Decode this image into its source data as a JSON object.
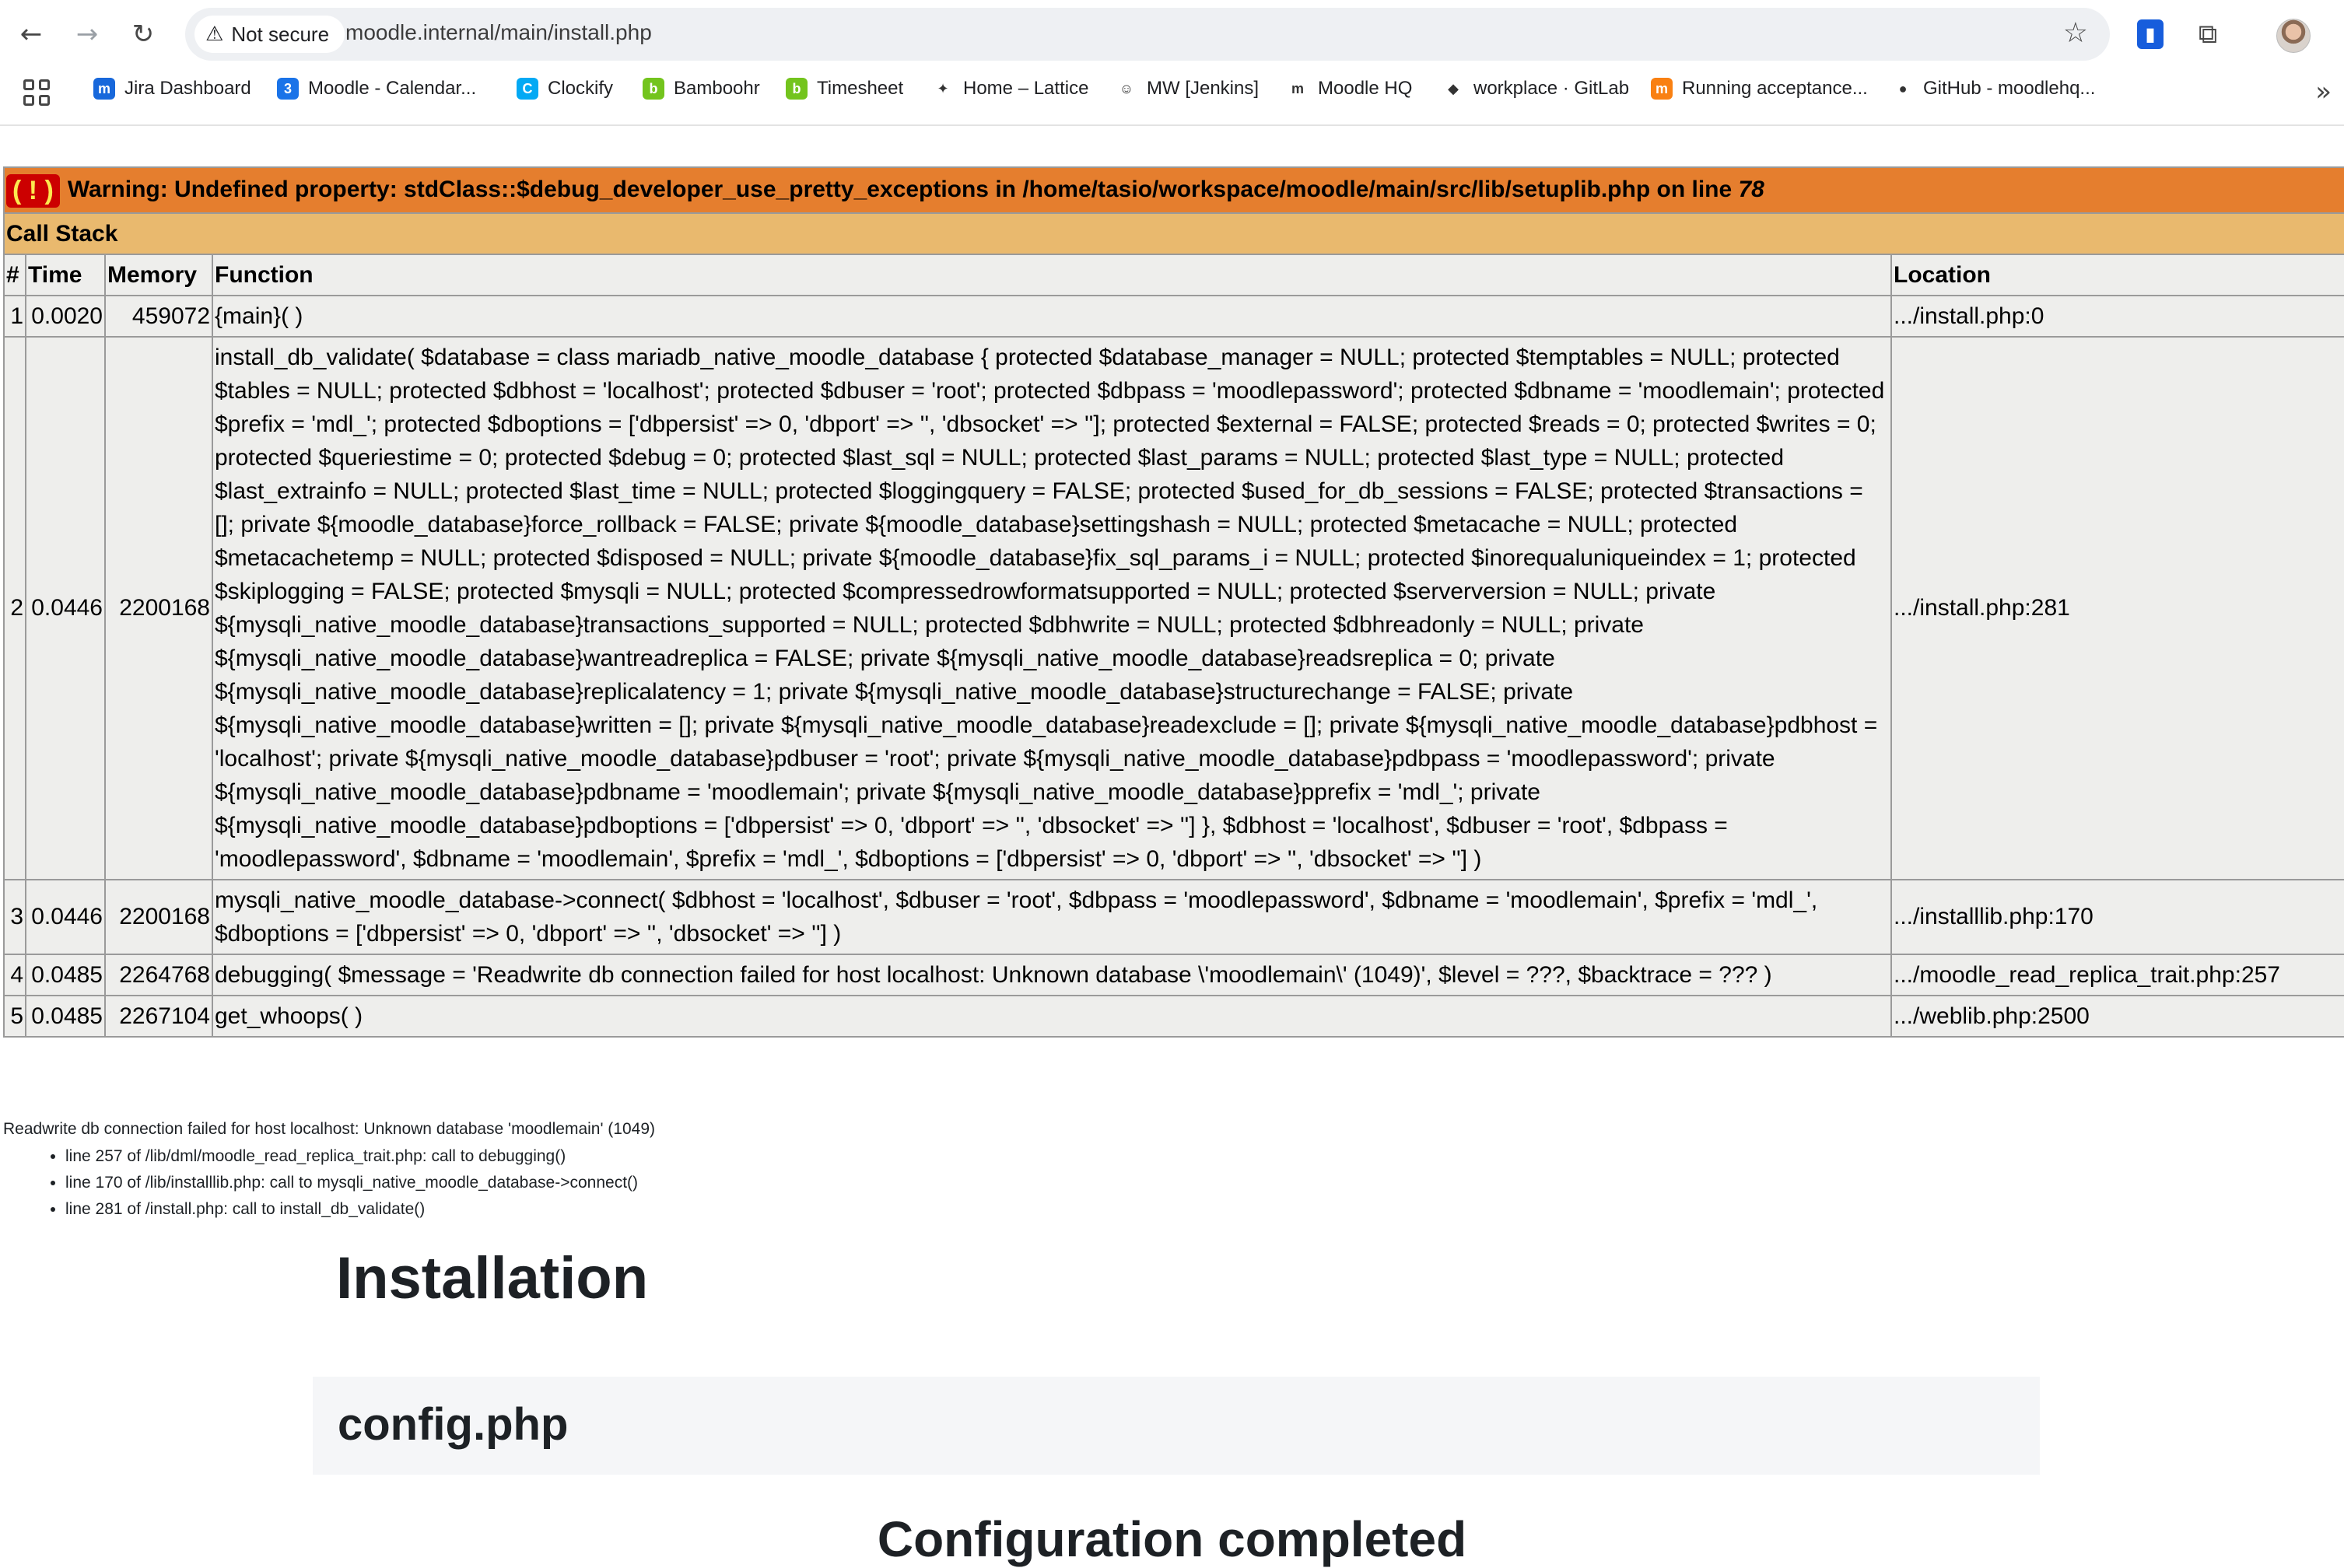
{
  "browser": {
    "security_label": "Not secure",
    "url": "moodle.internal/main/install.php",
    "bookmarks": [
      {
        "label": "Jira Dashboard",
        "color": "#1868db",
        "glyph": "m"
      },
      {
        "label": "Moodle - Calendar...",
        "color": "#1a73e8",
        "glyph": "3"
      },
      {
        "label": "Clockify",
        "color": "#03a9f4",
        "glyph": "C"
      },
      {
        "label": "Bamboohr",
        "color": "#73c41d",
        "glyph": "b"
      },
      {
        "label": "Timesheet",
        "color": "#73c41d",
        "glyph": "b"
      },
      {
        "label": "Home – Lattice",
        "color": "#ffffff",
        "glyph": "✦"
      },
      {
        "label": "MW [Jenkins]",
        "color": "#ffffff",
        "glyph": "☺"
      },
      {
        "label": "Moodle HQ",
        "color": "#ffffff",
        "glyph": "m"
      },
      {
        "label": "workplace · GitLab",
        "color": "#ffffff",
        "glyph": "◆"
      },
      {
        "label": "Running acceptance...",
        "color": "#f98012",
        "glyph": "m"
      },
      {
        "label": "GitHub - moodlehq...",
        "color": "#ffffff",
        "glyph": "●"
      }
    ]
  },
  "xdebug": {
    "badge": "( ! )",
    "warning_text": "Warning: Undefined property: stdClass::$debug_developer_use_pretty_exceptions in /home/tasio/workspace/moodle/main/src/lib/setuplib.php on line ",
    "warning_line": "78",
    "call_stack_label": "Call Stack",
    "columns": [
      "#",
      "Time",
      "Memory",
      "Function",
      "Location"
    ],
    "rows": [
      {
        "n": "1",
        "time": "0.0020",
        "memory": "459072",
        "function": "{main}( )",
        "location": ".../install.php:0"
      },
      {
        "n": "2",
        "time": "0.0446",
        "memory": "2200168",
        "function": "install_db_validate( $database = class mariadb_native_moodle_database { protected $database_manager = NULL; protected $temptables = NULL; protected $tables = NULL; protected $dbhost = 'localhost'; protected $dbuser = 'root'; protected $dbpass = 'moodlepassword'; protected $dbname = 'moodlemain'; protected $prefix = 'mdl_'; protected $dboptions = ['dbpersist' => 0, 'dbport' => '', 'dbsocket' => '']; protected $external = FALSE; protected $reads = 0; protected $writes = 0; protected $queriestime = 0; protected $debug = 0; protected $last_sql = NULL; protected $last_params = NULL; protected $last_type = NULL; protected $last_extrainfo = NULL; protected $last_time = NULL; protected $loggingquery = FALSE; protected $used_for_db_sessions = FALSE; protected $transactions = []; private ${moodle_database}force_rollback = FALSE; private ${moodle_database}settingshash = NULL; protected $metacache = NULL; protected $metacachetemp = NULL; protected $disposed = NULL; private ${moodle_database}fix_sql_params_i = NULL; protected $inorequaluniqueindex = 1; protected $skiplogging = FALSE; protected $mysqli = NULL; protected $compressedrowformatsupported = NULL; protected $serverversion = NULL; private ${mysqli_native_moodle_database}transactions_supported = NULL; protected $dbhwrite = NULL; protected $dbhreadonly = NULL; private ${mysqli_native_moodle_database}wantreadreplica = FALSE; private ${mysqli_native_moodle_database}readsreplica = 0; private ${mysqli_native_moodle_database}replicalatency = 1; private ${mysqli_native_moodle_database}structurechange = FALSE; private ${mysqli_native_moodle_database}written = []; private ${mysqli_native_moodle_database}readexclude = []; private ${mysqli_native_moodle_database}pdbhost = 'localhost'; private ${mysqli_native_moodle_database}pdbuser = 'root'; private ${mysqli_native_moodle_database}pdbpass = 'moodlepassword'; private ${mysqli_native_moodle_database}pdbname = 'moodlemain'; private ${mysqli_native_moodle_database}pprefix = 'mdl_'; private ${mysqli_native_moodle_database}pdboptions = ['dbpersist' => 0, 'dbport' => '', 'dbsocket' => ''] }, $dbhost = 'localhost', $dbuser = 'root', $dbpass = 'moodlepassword', $dbname = 'moodlemain', $prefix = 'mdl_', $dboptions = ['dbpersist' => 0, 'dbport' => '', 'dbsocket' => ''] )",
        "location": ".../install.php:281"
      },
      {
        "n": "3",
        "time": "0.0446",
        "memory": "2200168",
        "function": "mysqli_native_moodle_database->connect( $dbhost = 'localhost', $dbuser = 'root', $dbpass = 'moodlepassword', $dbname = 'moodlemain', $prefix = 'mdl_', $dboptions = ['dbpersist' => 0, 'dbport' => '', 'dbsocket' => ''] )",
        "location": ".../installlib.php:170"
      },
      {
        "n": "4",
        "time": "0.0485",
        "memory": "2264768",
        "function": "debugging( $message = 'Readwrite db connection failed for host localhost: Unknown database \\'moodlemain\\' (1049)', $level = ???, $backtrace = ??? )",
        "location": ".../moodle_read_replica_trait.php:257"
      },
      {
        "n": "5",
        "time": "0.0485",
        "memory": "2267104",
        "function": "get_whoops( )",
        "location": ".../weblib.php:2500"
      }
    ]
  },
  "debug_message": {
    "text": "Readwrite db connection failed for host localhost: Unknown database 'moodlemain' (1049)",
    "trace": [
      "line 257 of /lib/dml/moodle_read_replica_trait.php: call to debugging()",
      "line 170 of /lib/installlib.php: call to mysqli_native_moodle_database->connect()",
      "line 281 of /install.php: call to install_db_validate()"
    ]
  },
  "install": {
    "title": "Installation",
    "section_title": "config.php",
    "status_heading": "Configuration completed"
  }
}
